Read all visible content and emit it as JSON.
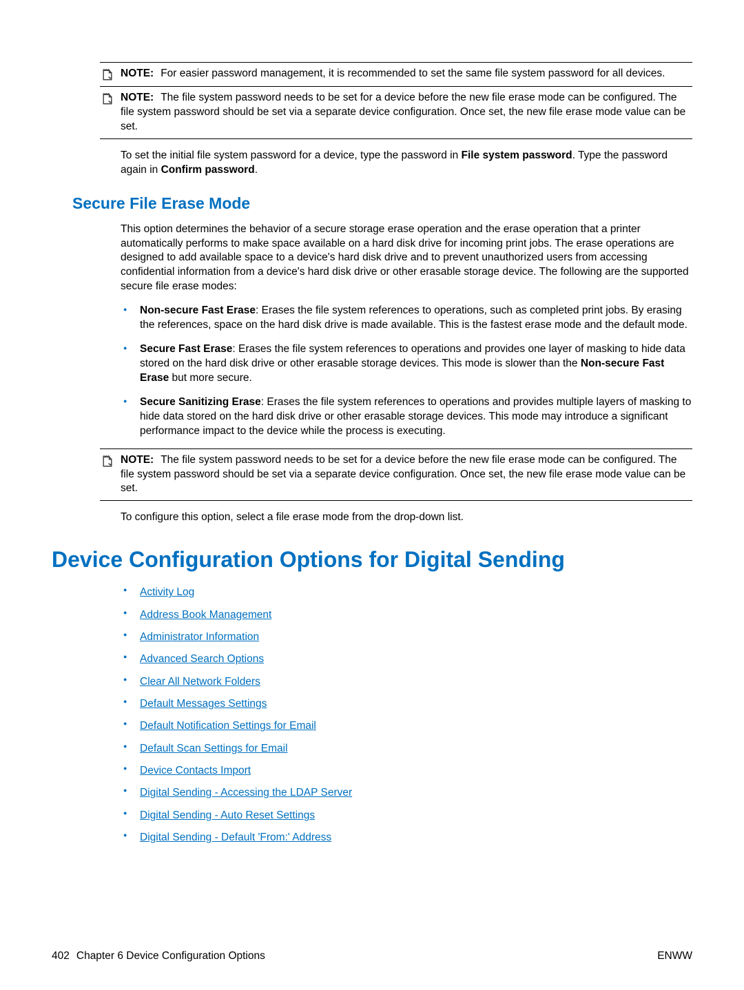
{
  "notes": {
    "label": "NOTE:",
    "n1": "For easier password management, it is recommended to set the same file system password for all devices.",
    "n2": "The file system password needs to be set for a device before the new file erase mode can be configured. The file system password should be set via a separate device configuration. Once set, the new file erase mode value can be set.",
    "n3": "The file system password needs to be set for a device before the new file erase mode can be configured. The file system password should be set via a separate device configuration. Once set, the new file erase mode value can be set."
  },
  "para": {
    "p1_a": "To set the initial file system password for a device, type the password in ",
    "p1_b": "File system password",
    "p1_c": ". Type the password again in ",
    "p1_d": "Confirm password",
    "p1_e": ".",
    "p2": "This option determines the behavior of a secure storage erase operation and the erase operation that a printer automatically performs to make space available on a hard disk drive for incoming print jobs. The erase operations are designed to add available space to a device's hard disk drive and to prevent unauthorized users from accessing confidential information from a device's hard disk drive or other erasable storage device. The following are the supported secure file erase modes:",
    "p3": "To configure this option, select a file erase mode from the drop-down list."
  },
  "headings": {
    "h2_secure": "Secure File Erase Mode",
    "h1_digital": "Device Configuration Options for Digital Sending"
  },
  "modes": {
    "m1_b": "Non-secure Fast Erase",
    "m1_t": ": Erases the file system references to operations, such as completed print jobs. By erasing the references, space on the hard disk drive is made available. This is the fastest erase mode and the default mode.",
    "m2_b": "Secure Fast Erase",
    "m2_t1": ": Erases the file system references to operations and provides one layer of masking to hide data stored on the hard disk drive or other erasable storage devices. This mode is slower than the ",
    "m2_b2": "Non-secure Fast Erase",
    "m2_t2": " but more secure.",
    "m3_b": "Secure Sanitizing Erase",
    "m3_t": ": Erases the file system references to operations and provides multiple layers of masking to hide data stored on the hard disk drive or other erasable storage devices. This mode may introduce a significant performance impact to the device while the process is executing."
  },
  "links": [
    "Activity Log",
    "Address Book Management",
    "Administrator Information",
    "Advanced Search Options",
    "Clear All Network Folders",
    "Default Messages Settings",
    "Default Notification Settings for Email",
    "Default Scan Settings for Email",
    "Device Contacts Import",
    "Digital Sending - Accessing the LDAP Server",
    "Digital Sending - Auto Reset Settings",
    "Digital Sending - Default 'From:' Address"
  ],
  "footer": {
    "page": "402",
    "chapter": "Chapter 6   Device Configuration Options",
    "right": "ENWW"
  }
}
